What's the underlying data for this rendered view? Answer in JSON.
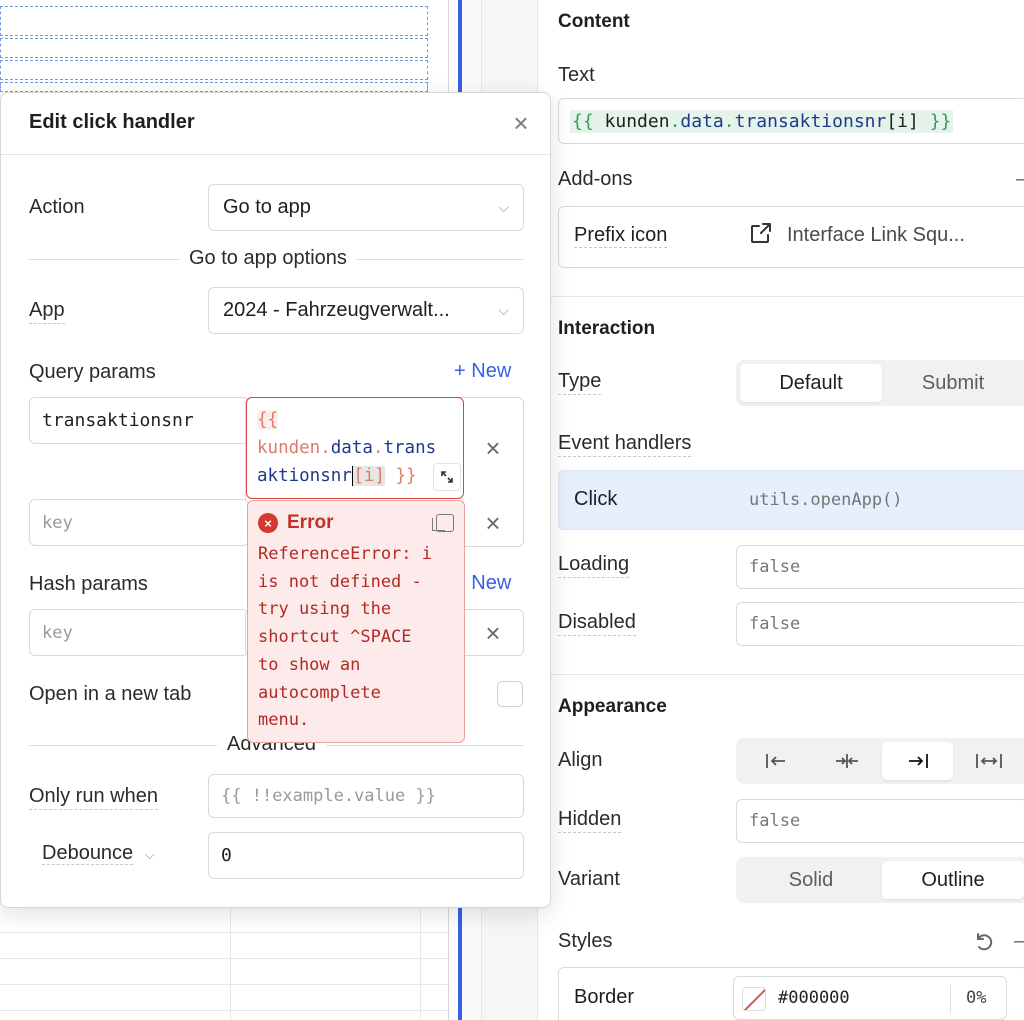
{
  "modal": {
    "title": "Edit click handler",
    "action_label": "Action",
    "action_value": "Go to app",
    "options_heading": "Go to app options",
    "app_label": "App",
    "app_value": "2024 - Fahrzeugverwalt...",
    "query_params_label": "Query params",
    "new_label": "New",
    "query_key_value": "transaktionsnr",
    "query_value_code": {
      "open": "{{",
      "var": "kunden",
      "dot1": ".",
      "prop1": "data",
      "dot2": ".",
      "prop2a": "trans",
      "prop2b": "aktionsnr",
      "index": "[i]",
      "close": "}}"
    },
    "key_placeholder": "key",
    "hash_params_label": "Hash params",
    "open_new_tab_label": "Open in a new tab",
    "advanced_heading": "Advanced",
    "only_run_when_label": "Only run when",
    "only_run_when_placeholder": "{{ !!example.value }}",
    "debounce_label": "Debounce",
    "debounce_value": "0"
  },
  "error": {
    "title": "Error",
    "message": "ReferenceError: i\nis not defined -\ntry using the\nshortcut ^SPACE\nto show an\nautocomplete\nmenu."
  },
  "inspector": {
    "content_title": "Content",
    "text_label": "Text",
    "text_value": {
      "open": "{{",
      "var": "kunden",
      "prop1": "data",
      "prop2": "transaktionsnr",
      "index": "[i]",
      "close": "}}"
    },
    "addons_label": "Add-ons",
    "prefix_icon_label": "Prefix icon",
    "prefix_icon_value": "Interface Link Squ...",
    "interaction_title": "Interaction",
    "type_label": "Type",
    "type_options": [
      "Default",
      "Submit"
    ],
    "event_handlers_label": "Event handlers",
    "event_name": "Click",
    "event_code": "utils.openApp()",
    "loading_label": "Loading",
    "loading_value": "false",
    "disabled_label": "Disabled",
    "disabled_value": "false",
    "appearance_title": "Appearance",
    "align_label": "Align",
    "hidden_label": "Hidden",
    "hidden_value": "false",
    "variant_label": "Variant",
    "variant_options": [
      "Solid",
      "Outline"
    ],
    "styles_label": "Styles",
    "border_label": "Border",
    "border_color": "#000000",
    "border_opacity": "0%"
  },
  "colors": {
    "accent": "#3b5ee6",
    "error": "#d6372f",
    "error_bg": "#fcebea",
    "token_green": "#2e9e57"
  },
  "icons": [
    "close-icon",
    "chevron-down-icon",
    "plus-icon",
    "expand-icon",
    "error-icon",
    "copy-icon",
    "external-link-icon",
    "reset-icon",
    "align-left-icon",
    "align-center-icon",
    "align-right-icon",
    "align-justify-icon",
    "no-color-icon"
  ]
}
